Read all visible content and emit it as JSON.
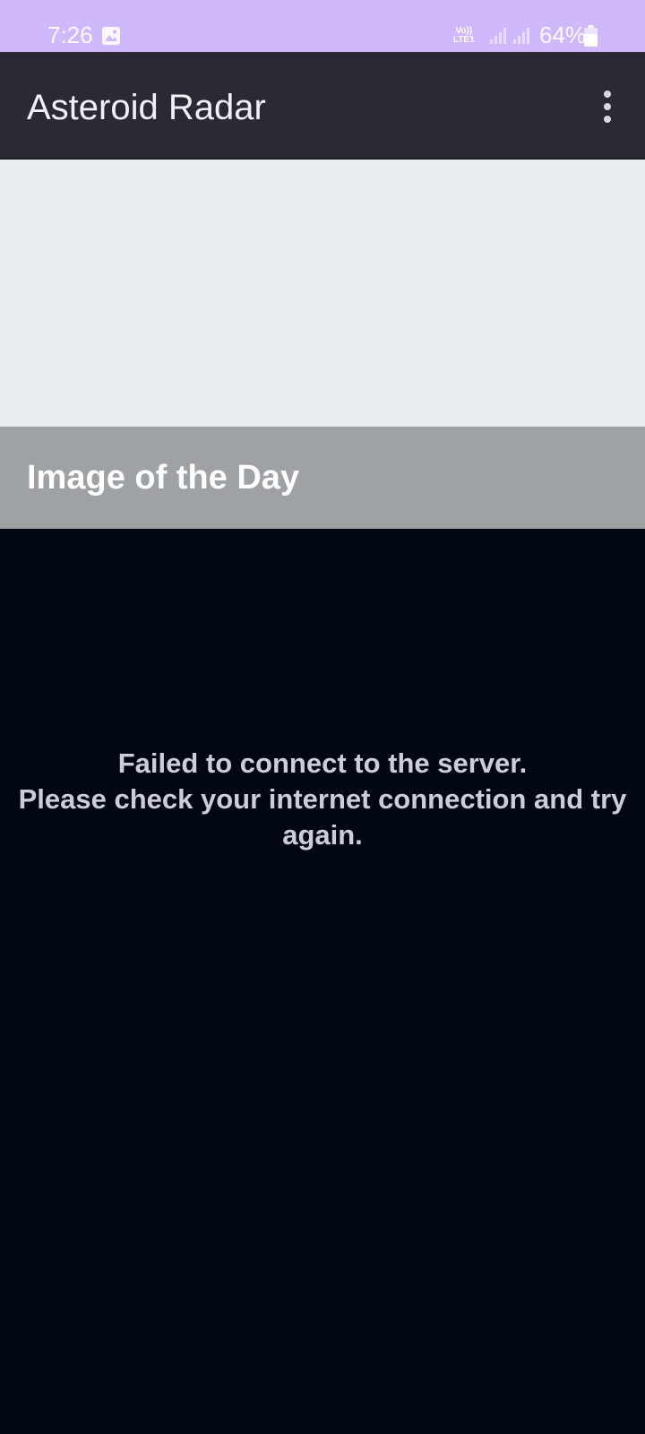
{
  "status_bar": {
    "time": "7:26",
    "volte_line1": "Vo))",
    "volte_line2": "LTE1",
    "battery": "64%",
    "icons": [
      "gallery-icon",
      "signal-icon",
      "signal-icon",
      "battery-icon"
    ],
    "background_color": "#cfb9fc"
  },
  "app_bar": {
    "title": "Asteroid Radar",
    "overflow_icon": "more-vert-icon",
    "background_color": "#2b2a34"
  },
  "image_of_day": {
    "caption": "Image of the Day",
    "placeholder_color": "#e9edef",
    "caption_bar_color": "#9ea2a5"
  },
  "content": {
    "error_message": "Failed to connect to the server.\nPlease check your internet connection and try again.",
    "background_color": "#010613"
  }
}
